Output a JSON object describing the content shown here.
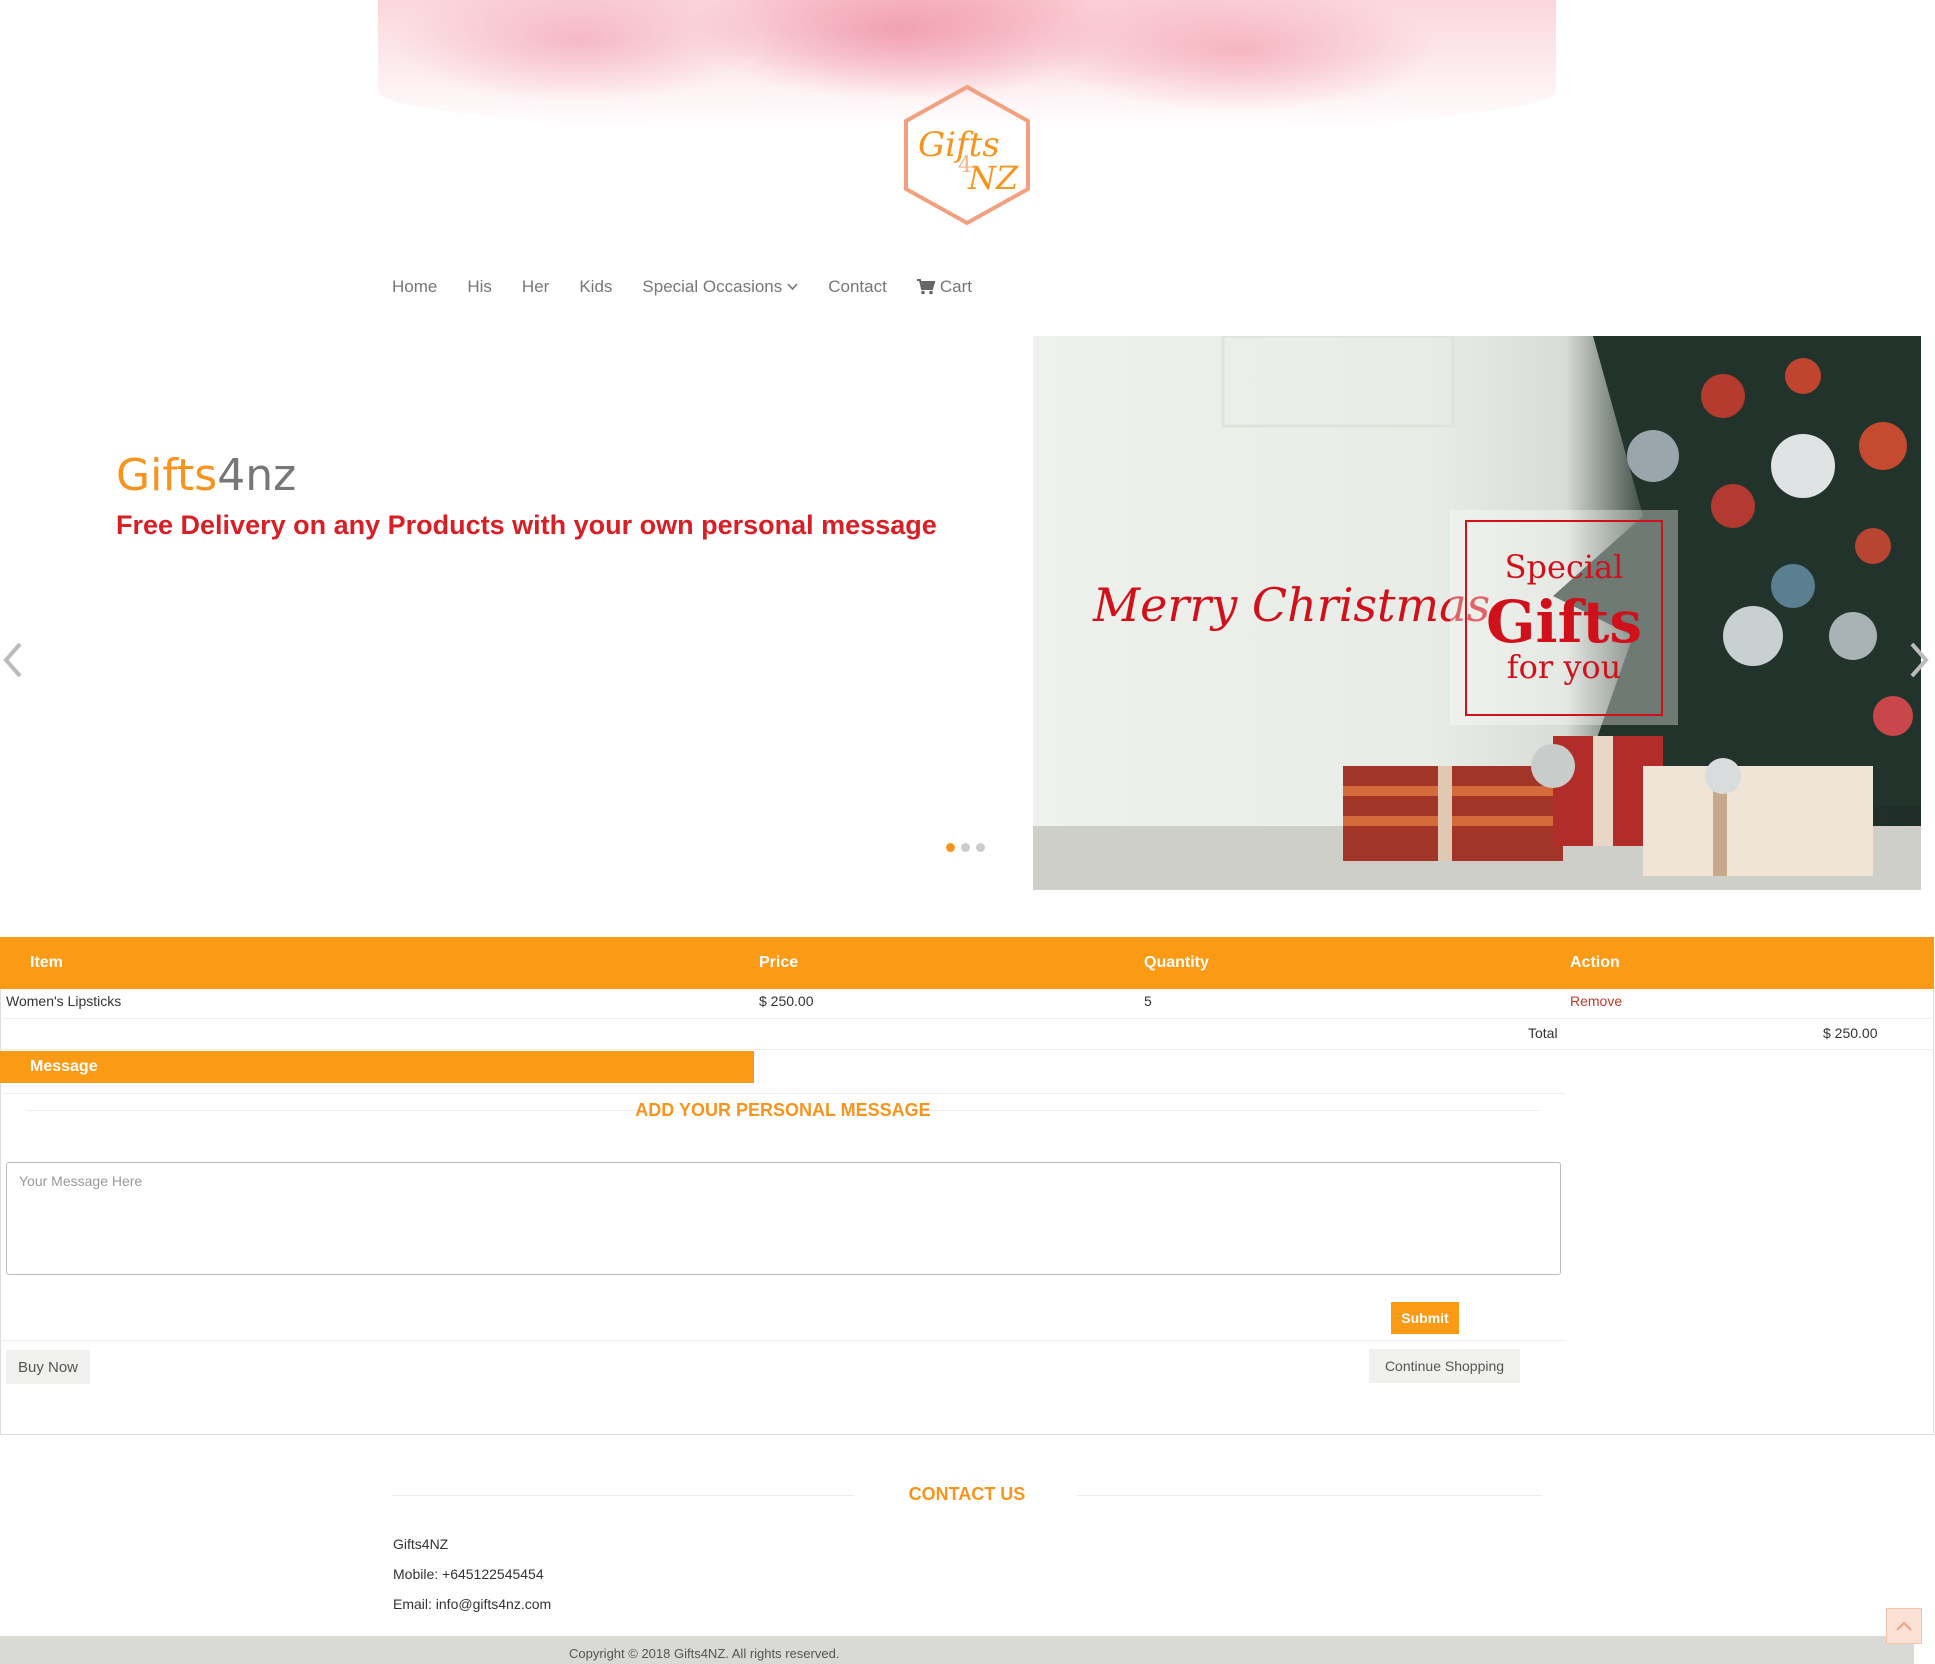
{
  "logo": {
    "top": "Gifts",
    "mid": "4",
    "bottom": "NZ"
  },
  "nav": {
    "items": [
      "Home",
      "His",
      "Her",
      "Kids",
      "Special Occasions",
      "Contact"
    ],
    "cart_label": "Cart"
  },
  "hero": {
    "brand_part1": "Gifts",
    "brand_part2": "4nz",
    "subtitle": "Free Delivery on any Products with your own personal message",
    "banner_text": "Merry Christmas",
    "banner_box": {
      "line1": "Special",
      "line2": "Gifts",
      "line3": "for you"
    },
    "slide_count": 3,
    "active_slide": 1
  },
  "cart": {
    "headers": {
      "item": "Item",
      "price": "Price",
      "quantity": "Quantity",
      "action": "Action"
    },
    "rows": [
      {
        "item": "Women's Lipsticks",
        "price": "$ 250.00",
        "quantity": "5",
        "action": "Remove"
      }
    ],
    "total_label": "Total",
    "total_value": "$ 250.00"
  },
  "message": {
    "header": "Message",
    "title": "ADD YOUR PERSONAL MESSAGE",
    "placeholder": "Your Message Here",
    "value": "",
    "submit_label": "Submit"
  },
  "actions": {
    "buy_now": "Buy Now",
    "continue_shopping": "Continue Shopping"
  },
  "contact": {
    "title": "CONTACT US",
    "company": "Gifts4NZ",
    "mobile": "Mobile: +645122545454",
    "email": "Email: info@gifts4nz.com"
  },
  "footer": {
    "copyright": "Copyright © 2018 Gifts4NZ. All rights reserved."
  },
  "colors": {
    "accent": "#fb9a14",
    "brand_red": "#d71f25",
    "banner_red": "#d0101a"
  }
}
